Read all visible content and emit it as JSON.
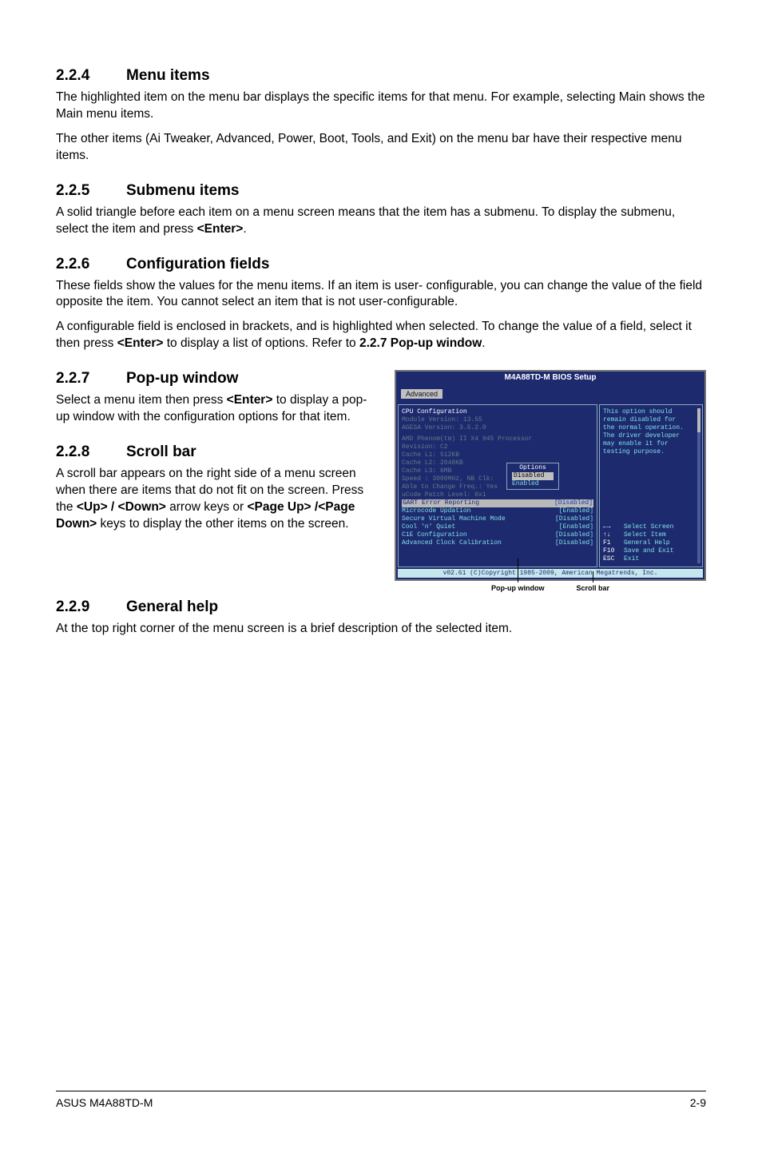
{
  "s224": {
    "num": "2.2.4",
    "title": "Menu items",
    "p1": "The highlighted item on the menu bar displays the specific items for that menu. For example, selecting Main shows the Main menu items.",
    "p2": "The other items (Ai Tweaker, Advanced, Power, Boot, Tools, and Exit) on the menu bar have their respective menu items."
  },
  "s225": {
    "num": "2.2.5",
    "title": "Submenu items",
    "p1a": "A solid triangle before each item on a menu screen means that the item has a submenu. To display the submenu, select the item and press ",
    "p1b": "<Enter>",
    "p1c": "."
  },
  "s226": {
    "num": "2.2.6",
    "title": "Configuration fields",
    "p1": "These fields show the values for the menu items. If an item is user- configurable, you can change the value of the field opposite the item. You cannot select an item that is not user-configurable.",
    "p2a": "A configurable field is enclosed in brackets, and is highlighted when selected. To change the value of a field, select it then press ",
    "p2b": "<Enter>",
    "p2c": " to display a list of options. Refer to ",
    "p2d": "2.2.7 Pop-up window",
    "p2e": "."
  },
  "s227": {
    "num": "2.2.7",
    "title": "Pop-up window",
    "p1a": "Select a menu item then press ",
    "p1b": "<Enter>",
    "p1c": " to display a pop-up window with the configuration options for that item."
  },
  "s228": {
    "num": "2.2.8",
    "title": "Scroll bar",
    "p1a": "A scroll bar appears on the right side of a menu screen when there are items that do not fit on the screen. Press the ",
    "p1b": "<Up> / <Down>",
    "p1c": " arrow keys or ",
    "p1d": "<Page Up> /<Page Down>",
    "p1e": " keys to display the other items on the screen."
  },
  "s229": {
    "num": "2.2.9",
    "title": "General help",
    "p1": "At the top right corner of the menu screen is a brief description of the selected item."
  },
  "bios": {
    "title": "M4A88TD-M BIOS Setup",
    "tab": "Advanced",
    "cpu_config": "CPU Configuration",
    "mod_ver": "Module Version: 13.55",
    "agesa": "AGESA Version: 3.5.2.0",
    "proc": "AMD Phenom(tm) II X4 945 Processor",
    "rev": "Revision: C2",
    "l1": "Cache L1: 512KB",
    "l2": "Cache L2: 2048KB",
    "l3": "Cache L3:  6MB",
    "speed": "Speed : 3000MHz,  NB Clk: ",
    "able": "Able to Change Freq.: Yes",
    "ucode": "uCode Patch Level: 0x1",
    "gart": "GART Error Reporting",
    "gart_val": "[Disabled]",
    "mc": "Microcode Updation",
    "mc_val": "[Enabled]",
    "svm": "Secure Virtual Machine Mode",
    "svm_val": "[Disabled]",
    "cnq": "Cool 'n' Quiet",
    "cnq_val": "[Enabled]",
    "c1e": "C1E Configuration",
    "c1e_val": "[Disabled]",
    "acc": "Advanced Clock Calibration",
    "acc_val": "[Disabled]",
    "popup_title": "Options",
    "popup_opt1": "Disabled",
    "popup_opt2": "Enabled",
    "help_l1": "This option should",
    "help_l2": "remain disabled for",
    "help_l3": "the normal operation.",
    "help_l4": "The driver developer",
    "help_l5": "may enable it for",
    "help_l6": "testing purpose.",
    "nav_sel_screen": "Select Screen",
    "nav_sel_item": "Select Item",
    "nav_f1": "F1",
    "nav_f1_d": "General Help",
    "nav_f10": "F10",
    "nav_f10_d": "Save and Exit",
    "nav_esc": "ESC",
    "nav_esc_d": "Exit",
    "footer": "v02.61 (C)Copyright 1985-2009, American Megatrends, Inc."
  },
  "callouts": {
    "popup": "Pop-up window",
    "scroll": "Scroll bar"
  },
  "footer": {
    "left": "ASUS M4A88TD-M",
    "right": "2-9"
  }
}
